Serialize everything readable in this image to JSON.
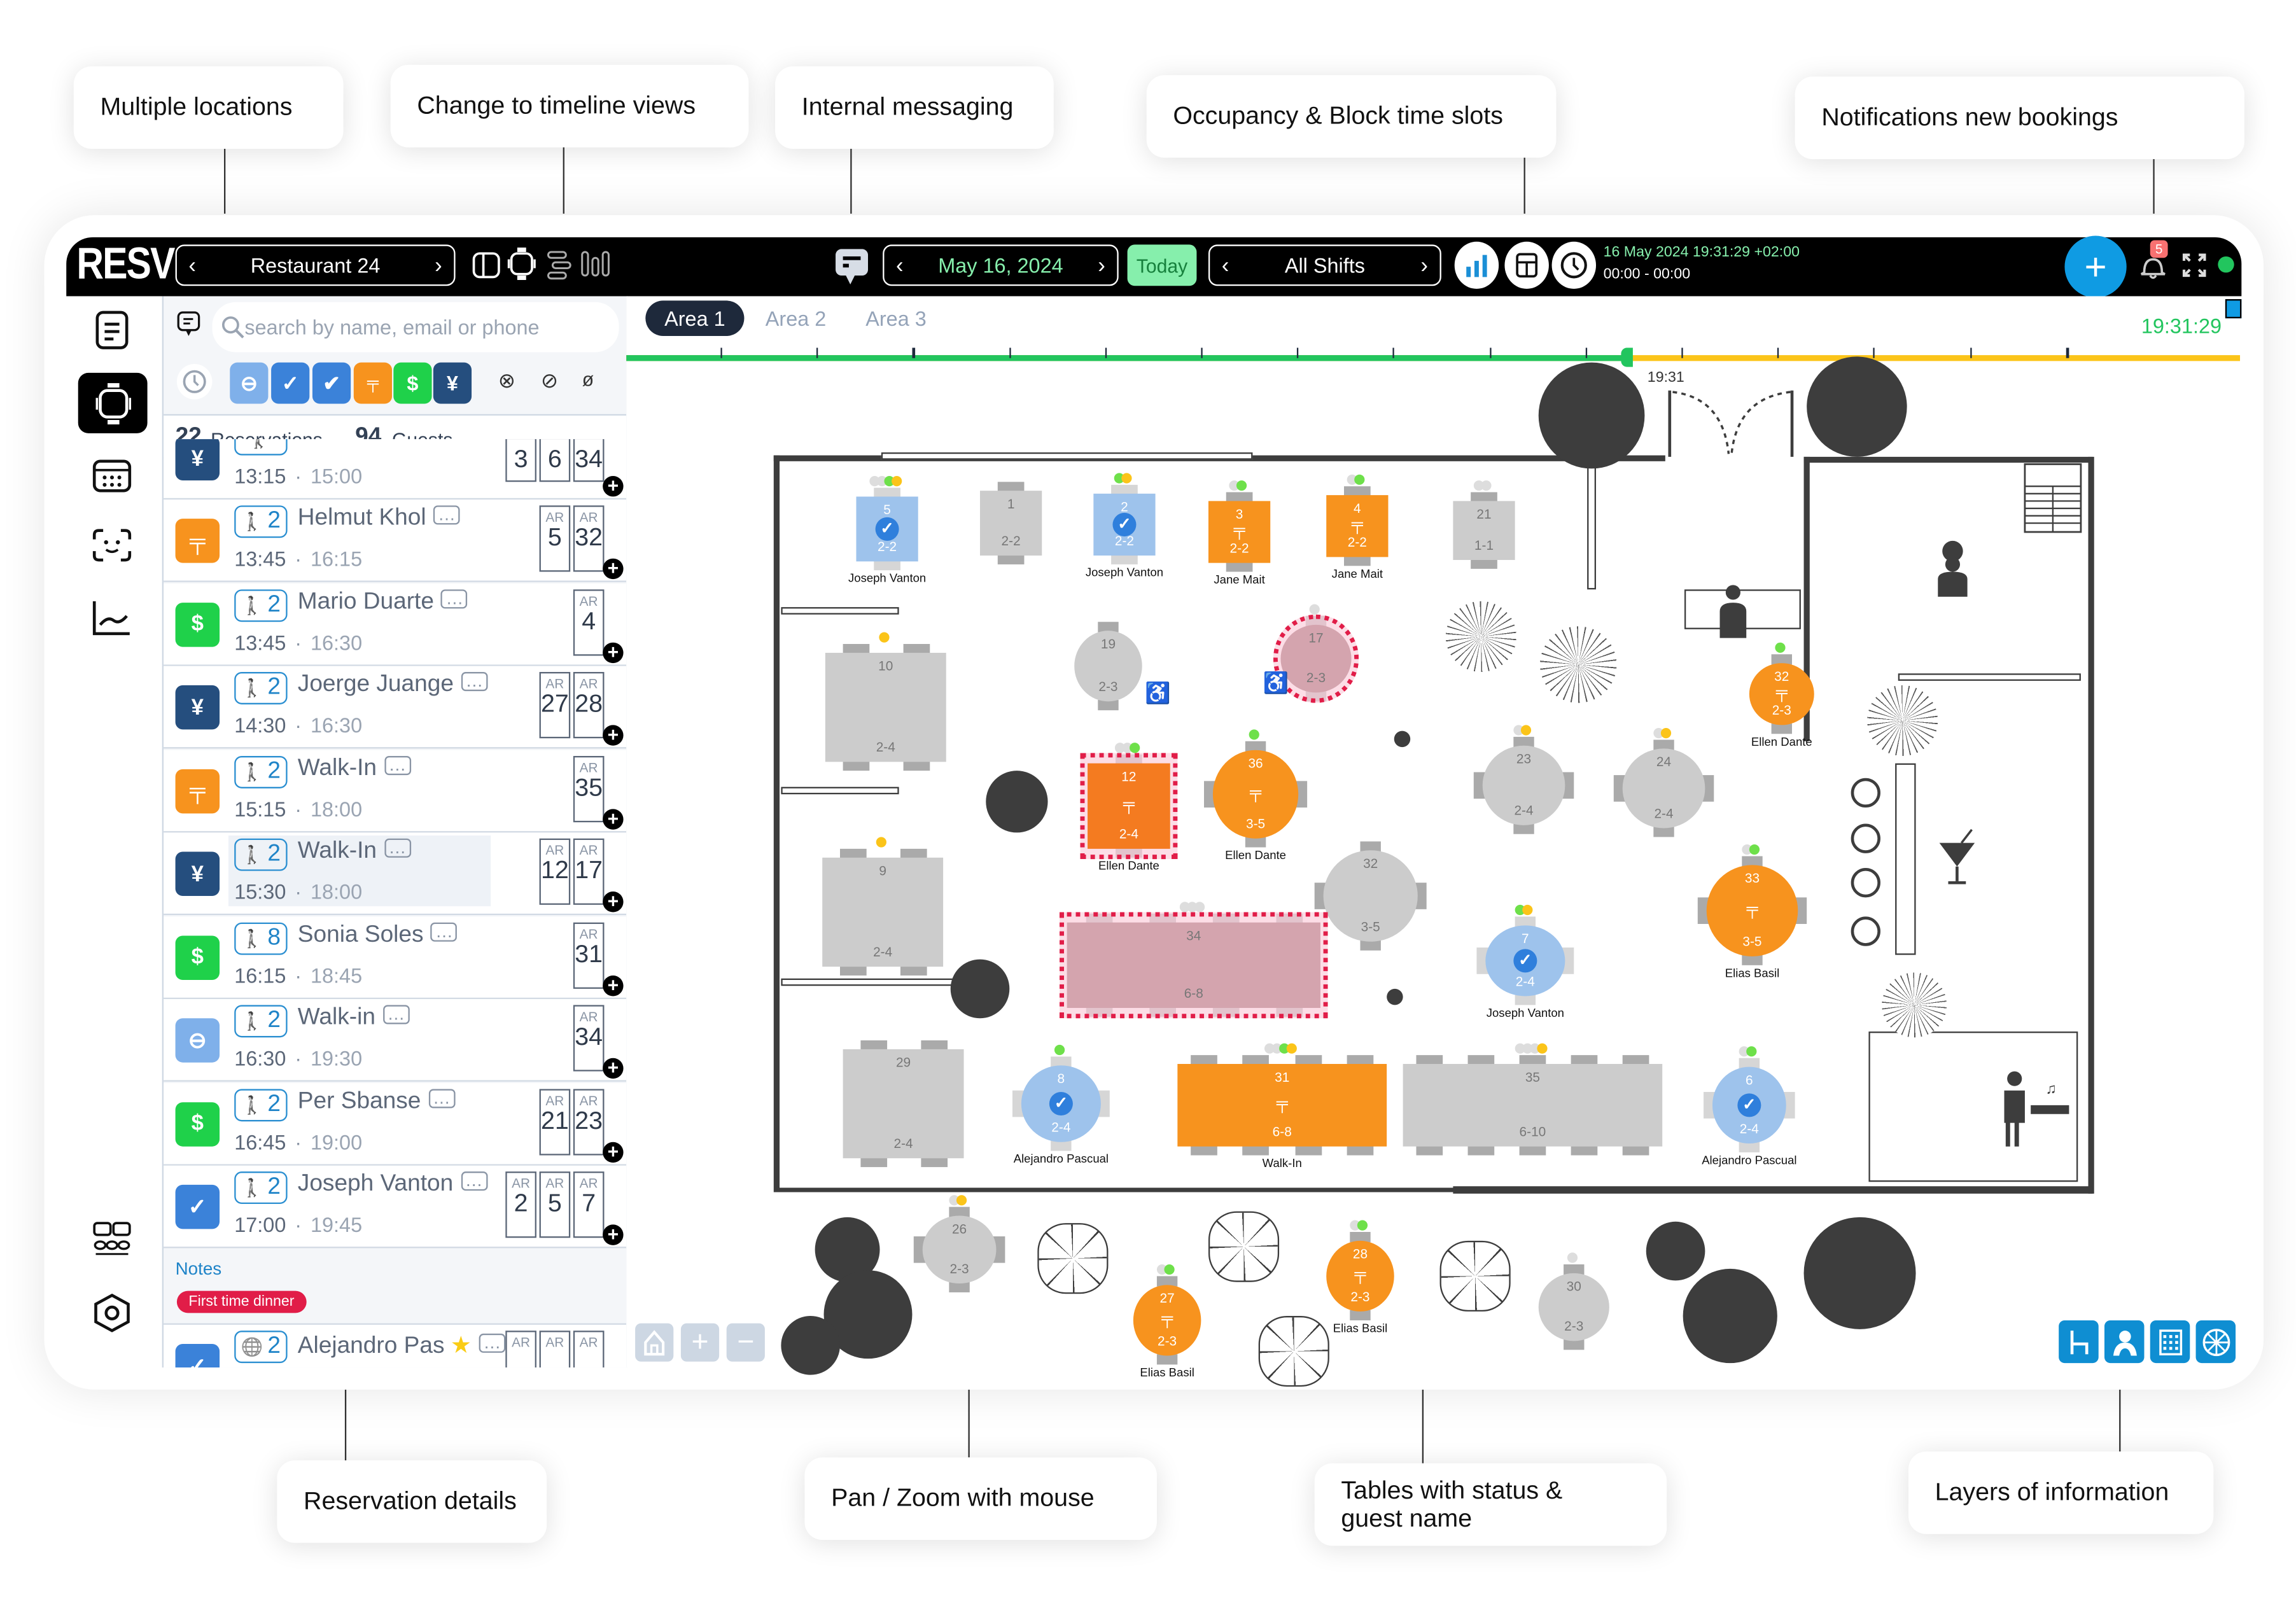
{
  "callouts": {
    "top": [
      "Multiple locations",
      "Change to timeline views",
      "Internal messaging",
      "Occupancy & Block time slots",
      "Notifications new bookings"
    ],
    "bottom": [
      "Reservation details",
      "Pan / Zoom with mouse",
      "Tables with status & guest name",
      "Layers of information"
    ]
  },
  "header": {
    "logo": "RESV",
    "location": "Restaurant 24",
    "date": "May 16, 2024",
    "today_label": "Today",
    "shift": "All Shifts",
    "datetime": "16 May 2024 19:31:29 +02:00",
    "time_range": "00:00 - 00:00",
    "notification_count": "5",
    "colors": {
      "accent": "#0f9be3",
      "green": "#86efac",
      "status_online": "#22c55e",
      "badge": "#f87171"
    }
  },
  "sidebar": {
    "search_placeholder": "search by name, email or phone",
    "reservations_count": "22",
    "reservations_label": "Reservations",
    "guests_count": "94",
    "guests_label": "Guests",
    "status_filters": [
      {
        "name": "pending",
        "color": "#7fb0ea"
      },
      {
        "name": "confirmed",
        "color": "#3b82d9"
      },
      {
        "name": "arrived",
        "color": "#3b82d9"
      },
      {
        "name": "seated",
        "color": "#f7931e"
      },
      {
        "name": "paid",
        "color": "#1fd14a"
      },
      {
        "name": "finished",
        "color": "#254e7e"
      },
      {
        "name": "no-show",
        "color": ""
      },
      {
        "name": "cancelled",
        "color": ""
      },
      {
        "name": "hidden",
        "color": ""
      }
    ],
    "reservations": [
      {
        "status": "finished",
        "pax": "",
        "name": "",
        "start": "13:15",
        "end": "15:00",
        "tables": [
          "3",
          "6",
          "34"
        ],
        "ar": false
      },
      {
        "status": "seated",
        "pax": "2",
        "name": "Helmut Khol",
        "start": "13:45",
        "end": "16:15",
        "tables": [
          "5",
          "32"
        ],
        "ar": true
      },
      {
        "status": "paid",
        "pax": "2",
        "name": "Mario Duarte",
        "start": "13:45",
        "end": "16:30",
        "tables": [
          "4"
        ],
        "ar": true
      },
      {
        "status": "finished",
        "pax": "2",
        "name": "Joerge Juange",
        "start": "14:30",
        "end": "16:30",
        "tables": [
          "27",
          "28"
        ],
        "ar": true
      },
      {
        "status": "seated",
        "pax": "2",
        "name": "Walk-In",
        "start": "15:15",
        "end": "18:00",
        "tables": [
          "35"
        ],
        "ar": true
      },
      {
        "status": "finished",
        "pax": "2",
        "name": "Walk-In",
        "start": "15:30",
        "end": "18:00",
        "tables": [
          "12",
          "17"
        ],
        "ar": true
      },
      {
        "status": "paid",
        "pax": "8",
        "name": "Sonia Soles",
        "start": "16:15",
        "end": "18:45",
        "tables": [
          "31"
        ],
        "ar": true
      },
      {
        "status": "pending",
        "pax": "2",
        "name": "Walk-in",
        "start": "16:30",
        "end": "19:30",
        "tables": [
          "34"
        ],
        "ar": true
      },
      {
        "status": "paid",
        "pax": "2",
        "name": "Per Sbanse",
        "start": "16:45",
        "end": "19:00",
        "tables": [
          "21",
          "23"
        ],
        "ar": true
      },
      {
        "status": "confirmed",
        "pax": "2",
        "name": "Joseph Vanton",
        "start": "17:00",
        "end": "19:45",
        "tables": [
          "2",
          "5",
          "7"
        ],
        "ar": true
      },
      {
        "status": "confirmed",
        "pax": "2",
        "name": "Alejandro Pas",
        "start": "",
        "end": "",
        "tables": [
          "",
          "",
          ""
        ],
        "ar": true
      }
    ],
    "ar_label": "AR",
    "notes_label": "Notes",
    "note_tag": "First time dinner"
  },
  "map": {
    "tabs": [
      "Area 1",
      "Area 2",
      "Area 3"
    ],
    "active_tab": 0,
    "clock": "19:31:29",
    "timeline_marker": "19:31",
    "timeline_progress_pct": 62,
    "tables": [
      {
        "id": "5",
        "cap": "2-2",
        "status": "confirmed",
        "guest": "Joseph Vanton",
        "shape": "rect"
      },
      {
        "id": "1",
        "cap": "2-2",
        "status": "free",
        "guest": "",
        "shape": "rect"
      },
      {
        "id": "2",
        "cap": "2-2",
        "status": "confirmed",
        "guest": "Joseph Vanton",
        "shape": "rect"
      },
      {
        "id": "3",
        "cap": "2-2",
        "status": "seated",
        "guest": "Jane Mait",
        "shape": "rect"
      },
      {
        "id": "4",
        "cap": "2-2",
        "status": "seated",
        "guest": "Jane Mait",
        "shape": "rect"
      },
      {
        "id": "21",
        "cap": "1-1",
        "status": "free",
        "guest": "",
        "shape": "rect"
      },
      {
        "id": "10",
        "cap": "2-4",
        "status": "free",
        "guest": "",
        "shape": "rect"
      },
      {
        "id": "19",
        "cap": "2-3",
        "status": "free",
        "guest": "",
        "shape": "round"
      },
      {
        "id": "17",
        "cap": "2-3",
        "status": "blocked",
        "guest": "",
        "shape": "round"
      },
      {
        "id": "32",
        "cap": "2-3",
        "status": "seated",
        "guest": "Ellen Dante",
        "shape": "round"
      },
      {
        "id": "12",
        "cap": "2-4",
        "status": "seated-blocked",
        "guest": "Ellen Dante",
        "shape": "rect"
      },
      {
        "id": "36",
        "cap": "3-5",
        "status": "seated",
        "guest": "Ellen Dante",
        "shape": "round"
      },
      {
        "id": "23",
        "cap": "2-4",
        "status": "free",
        "guest": "",
        "shape": "round"
      },
      {
        "id": "24",
        "cap": "2-4",
        "status": "free",
        "guest": "",
        "shape": "round"
      },
      {
        "id": "9",
        "cap": "2-4",
        "status": "free",
        "guest": "",
        "shape": "rect"
      },
      {
        "id": "32",
        "cap": "3-5",
        "status": "free",
        "guest": "",
        "shape": "round"
      },
      {
        "id": "34",
        "cap": "6-8",
        "status": "blocked",
        "guest": "",
        "shape": "rect"
      },
      {
        "id": "7",
        "cap": "2-4",
        "status": "confirmed",
        "guest": "Joseph Vanton",
        "shape": "round"
      },
      {
        "id": "33",
        "cap": "3-5",
        "status": "seated",
        "guest": "Elias Basil",
        "shape": "round"
      },
      {
        "id": "29",
        "cap": "2-4",
        "status": "free",
        "guest": "",
        "shape": "rect"
      },
      {
        "id": "8",
        "cap": "2-4",
        "status": "confirmed",
        "guest": "Alejandro Pascual",
        "shape": "round"
      },
      {
        "id": "31",
        "cap": "6-8",
        "status": "seated",
        "guest": "Walk-In",
        "shape": "rect"
      },
      {
        "id": "35",
        "cap": "6-10",
        "status": "free",
        "guest": "",
        "shape": "rect"
      },
      {
        "id": "6",
        "cap": "2-4",
        "status": "confirmed",
        "guest": "Alejandro Pascual",
        "shape": "round"
      },
      {
        "id": "26",
        "cap": "2-3",
        "status": "free",
        "guest": "",
        "shape": "round"
      },
      {
        "id": "27",
        "cap": "2-3",
        "status": "seated",
        "guest": "Elias Basil",
        "shape": "round"
      },
      {
        "id": "28",
        "cap": "2-3",
        "status": "seated",
        "guest": "Elias Basil",
        "shape": "round"
      },
      {
        "id": "30",
        "cap": "2-3",
        "status": "free",
        "guest": "",
        "shape": "round"
      }
    ],
    "status_colors": {
      "free": "#cccccc",
      "confirmed": "#9ec3ec",
      "seated": "#f7931e",
      "blocked": "#d4a4ae",
      "seated-blocked": "#f47b20",
      "dot_green": "#6ee04a",
      "dot_yellow": "#fbc419",
      "dot_grey": "#dddddd"
    },
    "layers": [
      "tables-layer",
      "guests-layer",
      "grid-layer",
      "decor-layer"
    ]
  }
}
